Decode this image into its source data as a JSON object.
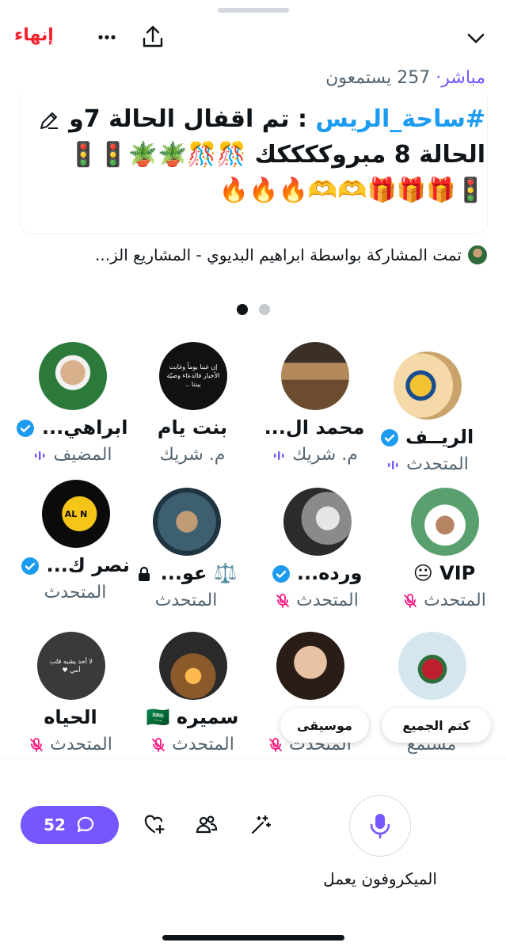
{
  "header": {
    "end_label": "إنهاء"
  },
  "meta": {
    "live": "مباشر",
    "separator": "·",
    "listeners": "257 يستمعون"
  },
  "title": {
    "hashtag": "#ساحة_الريس",
    "line1_rest": " : تم اقفال الحالة 7و",
    "line2": "الحالة 8 مبروككككك 🎊🎊🪴🪴🚦🚦",
    "line3": "🚦🎁🎁🎁🫶🫶🔥🔥🔥"
  },
  "shared_by": "تمت المشاركة بواسطة ابراهيم البديوي - المشاريع الز...",
  "pagination": {
    "total": 2,
    "active": 0
  },
  "speakers": [
    {
      "name": "الريــف",
      "verified": true,
      "role": "المتحدث",
      "role_icon": "sound-bars-icon"
    },
    {
      "name": "محمد ال...",
      "verified": false,
      "role": "م. شريك",
      "role_icon": "sound-bars-icon"
    },
    {
      "name": "بنت يام",
      "verified": false,
      "role": "م. شريك",
      "role_icon": "sound-bars-icon"
    },
    {
      "name": "ابراهي...",
      "verified": true,
      "role": "المضيف",
      "role_icon": "sound-bars-icon"
    },
    {
      "name": "VIP 😐",
      "verified": false,
      "role": "المتحدث",
      "role_icon": "muted-mic-icon"
    },
    {
      "name": "ورده...",
      "verified": true,
      "role": "المتحدث",
      "role_icon": "muted-mic-icon"
    },
    {
      "name": "⚖️ عو...",
      "verified": false,
      "role": "المتحدث",
      "role_icon": "none"
    },
    {
      "name": "نصر ك...",
      "verified": true,
      "role": "المتحدث",
      "role_icon": "none"
    },
    {
      "name": "",
      "verified": false,
      "role": "مستمع",
      "role_icon": "none"
    },
    {
      "name": "",
      "verified": false,
      "role": "المتحدث",
      "role_icon": "muted-mic-icon"
    },
    {
      "name": "سميره 🇸🇦",
      "verified": false,
      "role": "المتحدث",
      "role_icon": "muted-mic-icon"
    },
    {
      "name": "الحياه",
      "verified": false,
      "role": "المتحدث",
      "role_icon": "muted-mic-icon"
    }
  ],
  "avatar_texts": {
    "card_black": "إن غبنا يوماً وغابت الأخبار فالدعاء وصيّة بيننا ..",
    "card_gray": "لا أحد يشبه قلب أمي ♥",
    "card_alnassr": "AL N"
  },
  "pills": {
    "mute_all": "كتم الجميع",
    "music": "موسيقى"
  },
  "bottom": {
    "comment_count": "52",
    "mic_label": "الميكروفون يعمل"
  },
  "colors": {
    "accent": "#7856ff",
    "end": "#f4212e",
    "verified": "#1d9bf0",
    "muted": "#f91880"
  }
}
